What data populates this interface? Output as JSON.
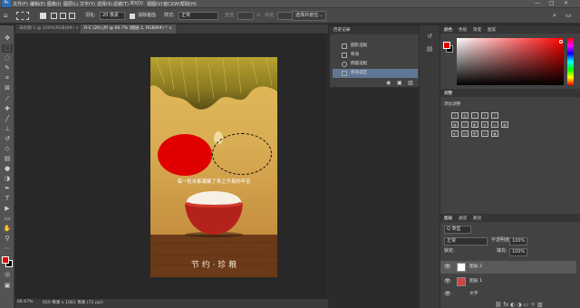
{
  "menubar": {
    "items": [
      "文件(F)",
      "编辑(E)",
      "图像(I)",
      "图层(L)",
      "文字(Y)",
      "选择(S)",
      "滤镜(T)",
      "3D(D)",
      "视图(V)",
      "窗口(W)",
      "帮助(H)"
    ],
    "window_buttons": [
      "—",
      "□",
      "×"
    ]
  },
  "options": {
    "feather_label": "羽化:",
    "feather_value": "20 像素",
    "antialias_label": "消除锯齿",
    "style_label": "样式:",
    "style_value": "正常",
    "width_label": "宽度:",
    "height_label": "高度:",
    "select_mask_button": "选择并遮住..."
  },
  "tabs": [
    {
      "label": "未标题-1 @ 100%(RGB/8#) ×",
      "active": false
    },
    {
      "label": "R-C (26).jfif @ 66.7% (图层 2, RGB/8#) *  ×",
      "active": true
    }
  ],
  "document": {
    "caption": "每一粒米都凝聚了来之不易的辛苦",
    "slogan": "节 约 · 珍 粮",
    "colors": {
      "red_circle": "#e10000",
      "bowl": "#b4231b"
    }
  },
  "status": {
    "zoom": "66.67%",
    "doc_info": "650 像素 x 1081 像素 (72 ppi)"
  },
  "history": {
    "title": "历史记录",
    "items": [
      {
        "label": "圆形选框",
        "selected": false
      },
      {
        "label": "移动",
        "selected": false
      },
      {
        "label": "椭圆选框",
        "selected": false
      },
      {
        "label": "移动选区",
        "selected": true
      }
    ]
  },
  "color_panel": {
    "tabs": [
      "颜色",
      "色板",
      "渐变",
      "图案"
    ],
    "foreground": "#e10000",
    "background": "#000000"
  },
  "adjust_panel": {
    "tab": "调整",
    "title": "添加调整"
  },
  "layers_panel": {
    "tabs": [
      "图层",
      "通道",
      "路径"
    ],
    "filter_value": "Q 类型",
    "blend_mode": "正常",
    "opacity_label": "不透明度:",
    "opacity_value": "100%",
    "lock_label": "锁定:",
    "fill_label": "填充:",
    "fill_value": "100%",
    "layers": [
      {
        "name": "图层 2",
        "selected": true
      },
      {
        "name": "图层 1",
        "selected": false
      },
      {
        "name": "文字",
        "selected": false
      }
    ]
  },
  "icons": [
    "move-icon",
    "marquee-icon",
    "lasso-icon",
    "quick-select-icon",
    "crop-icon",
    "eyedropper-icon",
    "healing-icon",
    "brush-icon",
    "stamp-icon",
    "history-brush-icon",
    "eraser-icon",
    "gradient-icon",
    "blur-icon",
    "dodge-icon",
    "pen-icon",
    "type-icon",
    "path-select-icon",
    "shape-icon",
    "hand-icon",
    "zoom-icon",
    "more-icon",
    "eye-icon",
    "search-icon"
  ]
}
